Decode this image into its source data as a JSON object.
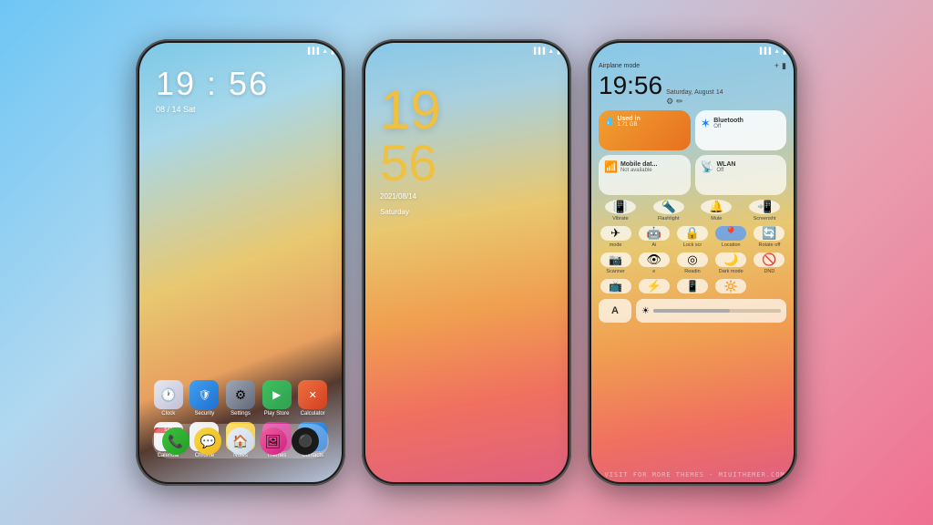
{
  "bg": {
    "gradient": "linear-gradient(135deg, #6ec6f5 0%, #b0d8f0 30%, #e8a0b0 70%, #f07090 100%)"
  },
  "watermark": ".VISIT FOR MORE THEMES - MIUITHEMER.COM",
  "phone1": {
    "time": "19 : 56",
    "date": "08 / 14  Sat",
    "apps_row1": [
      {
        "label": "Clock",
        "icon": "🕐",
        "class": "icon-clock"
      },
      {
        "label": "Security",
        "icon": "🛡",
        "class": "icon-security"
      },
      {
        "label": "Settings",
        "icon": "⚙",
        "class": "icon-settings"
      },
      {
        "label": "Play Store",
        "icon": "▶",
        "class": "icon-playstore"
      },
      {
        "label": "Calculator",
        "icon": "🔢",
        "class": "icon-calculator"
      }
    ],
    "apps_row2": [
      {
        "label": "Calendar",
        "icon": "14",
        "class": "icon-calendar"
      },
      {
        "label": "Chrome",
        "icon": "◉",
        "class": "icon-chrome"
      },
      {
        "label": "Notes",
        "icon": "📝",
        "class": "icon-notes"
      },
      {
        "label": "Themes",
        "icon": "🎨",
        "class": "icon-themes"
      },
      {
        "label": "Contacts",
        "icon": "👤",
        "class": "icon-contacts"
      }
    ],
    "dock": [
      {
        "icon": "📞",
        "class": "icon-phone"
      },
      {
        "icon": "💬",
        "class": "icon-messages"
      },
      {
        "icon": "📱",
        "class": "icon-miui"
      },
      {
        "icon": "🖼",
        "class": "icon-gallery"
      },
      {
        "icon": "⚫",
        "class": "icon-camera"
      }
    ]
  },
  "phone2": {
    "hour": "19",
    "minute": "56",
    "date_line1": "2021/08/14",
    "date_line2": "Saturday"
  },
  "phone3": {
    "airplane_mode": "Airplane mode",
    "time": "19:56",
    "date": "Saturday, August 14",
    "tiles": {
      "data_used": "Used in",
      "data_amount": "1.71 GB",
      "bluetooth_label": "Bluetooth",
      "bluetooth_sub": "Off",
      "mobile_data_label": "Mobile dat...",
      "mobile_data_sub": "Not available",
      "wlan_label": "WLAN",
      "wlan_sub": "Off"
    },
    "toggles": [
      "Vibrate",
      "Flashlight",
      "Mute",
      "Screensht"
    ],
    "big_toggles": [
      "mode",
      "Ai",
      "Lock scr",
      "Location",
      "Rotate off"
    ],
    "row3": [
      "Scanner",
      "e",
      "Readin",
      "Dark mode",
      "DND"
    ],
    "row4": [
      "",
      "⚡",
      "",
      ""
    ],
    "font_icon": "A",
    "brightness": 60
  }
}
